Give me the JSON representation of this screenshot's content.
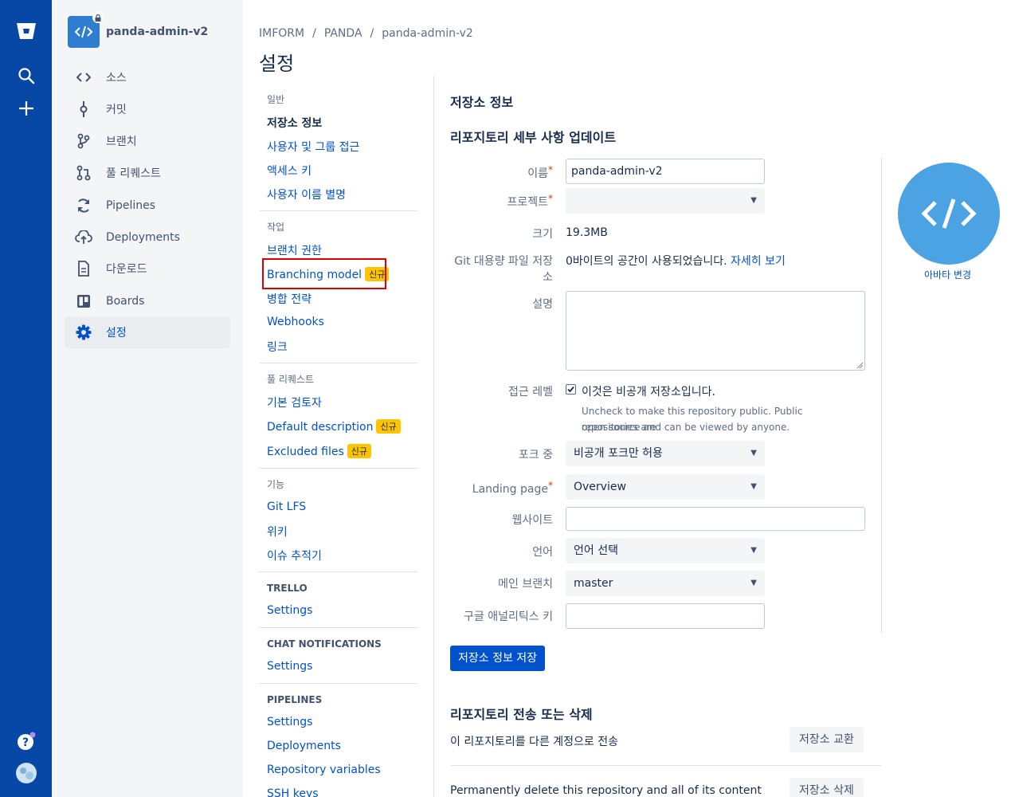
{
  "repo": {
    "name": "panda-admin-v2"
  },
  "sidebar": {
    "items": [
      {
        "label": "소스",
        "icon": "source-icon"
      },
      {
        "label": "커밋",
        "icon": "commit-icon"
      },
      {
        "label": "브랜치",
        "icon": "branch-icon"
      },
      {
        "label": "풀 리퀘스트",
        "icon": "pull-request-icon"
      },
      {
        "label": "Pipelines",
        "icon": "pipelines-icon"
      },
      {
        "label": "Deployments",
        "icon": "deployments-icon"
      },
      {
        "label": "다운로드",
        "icon": "download-icon"
      },
      {
        "label": "Boards",
        "icon": "boards-icon"
      },
      {
        "label": "설정",
        "icon": "settings-icon"
      }
    ]
  },
  "breadcrumb": [
    "IMFORM",
    "PANDA",
    "panda-admin-v2"
  ],
  "page_title": "설정",
  "settings_nav": {
    "general_title": "일반",
    "general": [
      "저장소 정보",
      "사용자 및 그룹 접근",
      "액세스 키",
      "사용자 이름 별명"
    ],
    "workflow_title": "작업",
    "workflow": [
      "브랜치 권한",
      "Branching model",
      "병합 전략",
      "Webhooks",
      "링크"
    ],
    "pr_title": "풀 리퀘스트",
    "pr": [
      "기본 검토자",
      "Default description",
      "Excluded files"
    ],
    "features_title": "기능",
    "features": [
      "Git LFS",
      "위키",
      "이슈 추적기"
    ],
    "trello_title": "TRELLO",
    "trello": [
      "Settings"
    ],
    "chat_title": "CHAT NOTIFICATIONS",
    "chat": [
      "Settings"
    ],
    "pipelines_title": "PIPELINES",
    "pipelines": [
      "Settings",
      "Deployments",
      "Repository variables",
      "SSH keys"
    ],
    "new_badge": "신규"
  },
  "form": {
    "section_title": "저장소 정보",
    "update_title": "리포지토리 세부 사항 업데이트",
    "name_label": "이름",
    "name_value": "panda-admin-v2",
    "project_label": "프로젝트",
    "project_value": "",
    "size_label": "크기",
    "size_value": "19.3MB",
    "lfs_label_1": "Git 대용량 파일 저장",
    "lfs_label_2": "소",
    "lfs_value": "0바이트의 공간이 사용되었습니다.",
    "lfs_link": "자세히 보기",
    "description_label": "설명",
    "description_value": "",
    "access_label": "접근 레벨",
    "access_checkbox_label": "이것은 비공개 저장소입니다.",
    "access_checked": true,
    "access_help_1": "Uncheck to make this repository public. Public repositories are",
    "access_help_2": "open source and can be viewed by anyone.",
    "fork_label": "포크 중",
    "fork_value": "비공개 포크만 허용",
    "landing_label": "Landing page",
    "landing_value": "Overview",
    "website_label": "웹사이트",
    "website_value": "",
    "language_label": "언어",
    "language_value": "언어 선택",
    "main_branch_label": "메인 브랜치",
    "main_branch_value": "master",
    "ga_label": "구글 애널리틱스 키",
    "ga_value": "",
    "save_button": "저장소 정보 저장",
    "avatar_change": "아바타 변경"
  },
  "danger": {
    "title": "리포지토리 전송 또는 삭제",
    "transfer_text": "이 리포지토리를 다른 계정으로 전송",
    "transfer_button": "저장소 교환",
    "delete_text": "Permanently delete this repository and all of its content",
    "delete_button": "저장소 삭제"
  },
  "colors": {
    "global_nav": "#0747a6",
    "primary": "#0052cc",
    "badge": "#ffc400",
    "avatar": "#4ba3e3"
  }
}
